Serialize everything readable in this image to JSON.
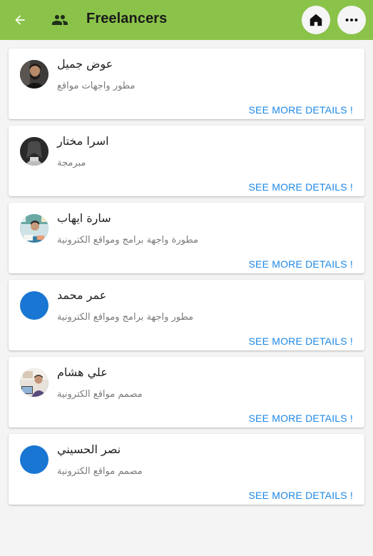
{
  "appbar": {
    "title": "Freelancers",
    "back_icon": "arrow-back-icon",
    "group_icon": "people-icon",
    "home_icon": "home-icon",
    "more_icon": "more-horiz-icon",
    "color": "#8bc34a"
  },
  "freelancers": [
    {
      "name": "عوض جميل",
      "role": "مطور واجهات مواقع",
      "details_label": "SEE MORE DETAILS !"
    },
    {
      "name": "اسرا مختار",
      "role": "مبرمجة",
      "details_label": "SEE MORE DETAILS !"
    },
    {
      "name": "سارة ايهاب",
      "role": "مطورة واجهة برامج ومواقع الكترونية",
      "details_label": "SEE MORE DETAILS !"
    },
    {
      "name": "عمر محمد",
      "role": "مطور واجهة برامج ومواقع الكترونية",
      "details_label": "SEE MORE DETAILS !"
    },
    {
      "name": "علي هشام",
      "role": "مصمم مواقع الكترونية",
      "details_label": "SEE MORE DETAILS !"
    },
    {
      "name": "نصر الحسيني",
      "role": "مصمم مواقع الكترونية",
      "details_label": "SEE MORE DETAILS !"
    }
  ],
  "colors": {
    "accent_link": "#1e88e5",
    "placeholder_avatar": "#1976d2"
  }
}
